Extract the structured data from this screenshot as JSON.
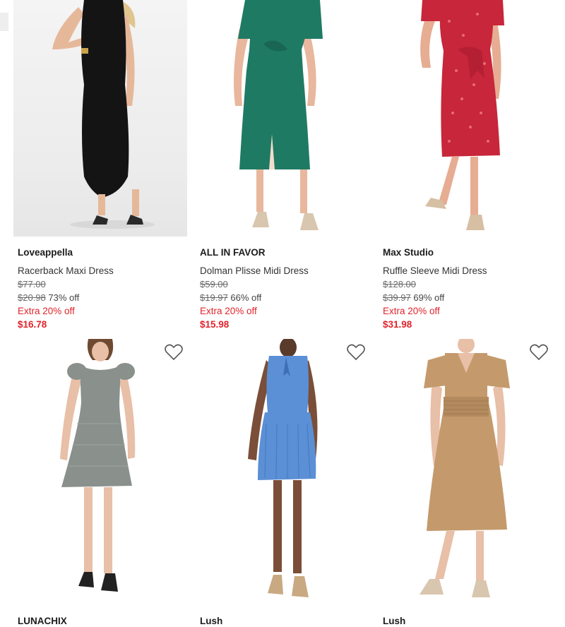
{
  "products_row1": [
    {
      "brand": "Loveappella",
      "name": "Racerback Maxi Dress",
      "original_price": "$77.00",
      "compare_price": "$20.98",
      "discount": "73% off",
      "extra_promo": "Extra 20% off",
      "final_price": "$16.78",
      "dress_color": "#141414",
      "image_icon": "black-maxi-dress-photo"
    },
    {
      "brand": "ALL IN FAVOR",
      "name": "Dolman Plisse Midi Dress",
      "original_price": "$59.00",
      "compare_price": "$19.97",
      "discount": "66% off",
      "extra_promo": "Extra 20% off",
      "final_price": "$15.98",
      "dress_color": "#1f7a63",
      "image_icon": "green-midi-dress-photo"
    },
    {
      "brand": "Max Studio",
      "name": "Ruffle Sleeve Midi Dress",
      "original_price": "$128.00",
      "compare_price": "$39.97",
      "discount": "69% off",
      "extra_promo": "Extra 20% off",
      "final_price": "$31.98",
      "dress_color": "#c8263a",
      "image_icon": "red-print-midi-dress-photo"
    }
  ],
  "products_row2": [
    {
      "brand": "LUNACHIX",
      "dress_color": "#8a908c",
      "image_icon": "gray-mini-dress-photo",
      "heart_icon": "heart-outline-icon"
    },
    {
      "brand": "Lush",
      "dress_color": "#5b8fd6",
      "image_icon": "blue-halter-mini-dress-photo",
      "heart_icon": "heart-outline-icon"
    },
    {
      "brand": "Lush",
      "dress_color": "#c49a6c",
      "image_icon": "tan-smocked-midi-dress-photo",
      "heart_icon": "heart-outline-icon"
    }
  ],
  "colors": {
    "sale_red": "#e0232a",
    "strike_gray": "#6b6b6b"
  }
}
